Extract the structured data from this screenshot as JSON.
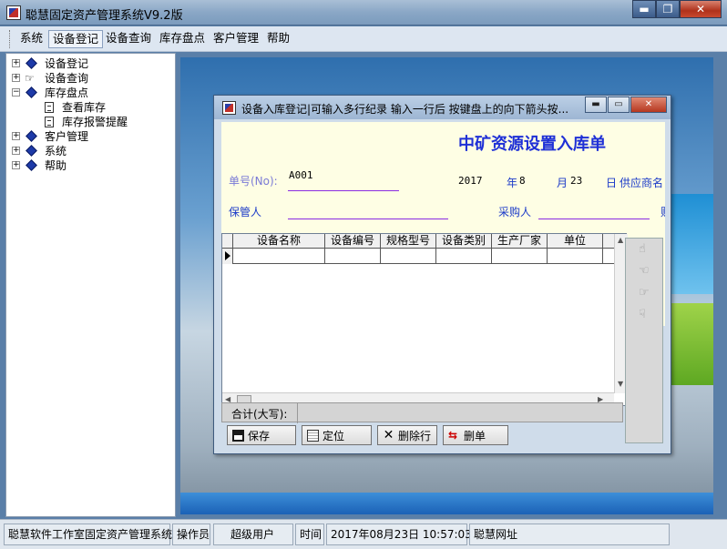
{
  "window": {
    "title": "聪慧固定资产管理系统V9.2版",
    "min": "▬",
    "max": "❐",
    "close": "✕"
  },
  "menu": [
    "系统",
    "设备登记",
    "设备查询",
    "库存盘点",
    "客户管理",
    "帮助"
  ],
  "tree": {
    "nodes": [
      {
        "label": "设备登记",
        "toggle": "+"
      },
      {
        "label": "设备查询",
        "toggle": "+"
      },
      {
        "label": "库存盘点",
        "toggle": "−"
      },
      {
        "label": "查看库存"
      },
      {
        "label": "库存报警提醒"
      },
      {
        "label": "客户管理",
        "toggle": "+"
      },
      {
        "label": "系统",
        "toggle": "+"
      },
      {
        "label": "帮助",
        "toggle": "+"
      }
    ]
  },
  "dialog": {
    "title": "设备入库登记|可输入多行纪录 输入一行后 按键盘上的向下箭头按...",
    "btn_min": "▬",
    "btn_max": "▭",
    "btn_close": "✕",
    "form_title": "中矿资源设置入库单",
    "order_label": "单号(No):",
    "order_value": "A001",
    "year": "2017",
    "year_unit": "年",
    "month": "8",
    "month_unit": "月",
    "day": "23",
    "day_unit": "日",
    "supplier_label": "供应商名",
    "keeper_label": "保管人",
    "buyer_label": "采购人",
    "trail_char": "财",
    "columns": [
      "设备名称",
      "设备编号",
      "规格型号",
      "设备类别",
      "生产厂家",
      "单位"
    ],
    "sum_label": "合计(大写):",
    "buttons": {
      "save": "保存",
      "locate": "定位",
      "delete_row": "删除行",
      "delete_bill": "删单"
    }
  },
  "status": {
    "studio": "聪慧软件工作室固定资产管理系统",
    "operator_label": "操作员",
    "operator": "超级用户",
    "time_label": "时间",
    "time": "2017年08月23日 10:57:03",
    "site": "聪慧网址"
  }
}
